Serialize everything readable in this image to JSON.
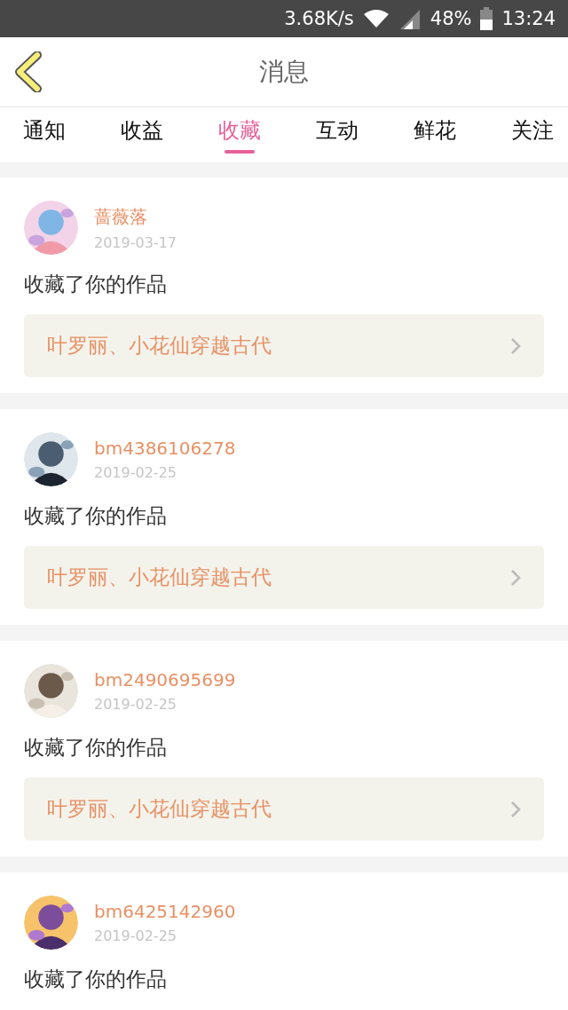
{
  "status_bar": {
    "speed": "3.68K/s",
    "battery": "48%",
    "time": "13:24"
  },
  "header": {
    "title": "消息"
  },
  "tabs": [
    {
      "label": "通知",
      "selected": false
    },
    {
      "label": "收益",
      "selected": false
    },
    {
      "label": "收藏",
      "selected": true
    },
    {
      "label": "互动",
      "selected": false
    },
    {
      "label": "鲜花",
      "selected": false
    },
    {
      "label": "关注",
      "selected": false
    }
  ],
  "messages": [
    {
      "user": "蔷薇落",
      "date": "2019-03-17",
      "text": "收藏了你的作品",
      "work": "叶罗丽、小花仙穿越古代"
    },
    {
      "user": "bm4386106278",
      "date": "2019-02-25",
      "text": "收藏了你的作品",
      "work": "叶罗丽、小花仙穿越古代"
    },
    {
      "user": "bm2490695699",
      "date": "2019-02-25",
      "text": "收藏了你的作品",
      "work": "叶罗丽、小花仙穿越古代"
    },
    {
      "user": "bm6425142960",
      "date": "2019-02-25",
      "text": "收藏了你的作品"
    }
  ]
}
